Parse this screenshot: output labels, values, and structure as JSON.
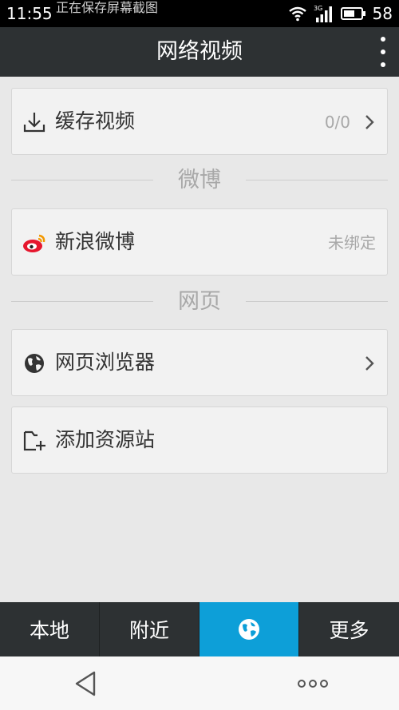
{
  "status_bar": {
    "time": "11:55",
    "toast": "正在保存屏幕截图",
    "network_label": "3G",
    "battery_level": "58",
    "icons": [
      "wifi-icon",
      "signal-3g-icon",
      "battery-icon"
    ]
  },
  "app_bar": {
    "title": "网络视频",
    "overflow_icon": "overflow-menu-icon"
  },
  "list": {
    "cache": {
      "label": "缓存视频",
      "value": "0/0",
      "icon": "download-icon"
    },
    "weibo_section": "微博",
    "weibo": {
      "label": "新浪微博",
      "value": "未绑定",
      "icon": "weibo-icon"
    },
    "web_section": "网页",
    "browser": {
      "label": "网页浏览器",
      "icon": "globe-icon"
    },
    "add_source": {
      "label": "添加资源站",
      "icon": "add-folder-icon"
    }
  },
  "bottom_nav": {
    "tabs": [
      {
        "label": "本地"
      },
      {
        "label": "附近"
      },
      {
        "label": "",
        "icon": "globe-icon",
        "active": true
      },
      {
        "label": "更多"
      }
    ]
  },
  "system_nav": {
    "back_icon": "back-triangle-icon",
    "menu_icon": "more-dots-icon"
  },
  "colors": {
    "app_bar": "#2d3133",
    "active_tab": "#0d9fd8",
    "background": "#e8e8e8",
    "card": "#f2f2f2"
  }
}
